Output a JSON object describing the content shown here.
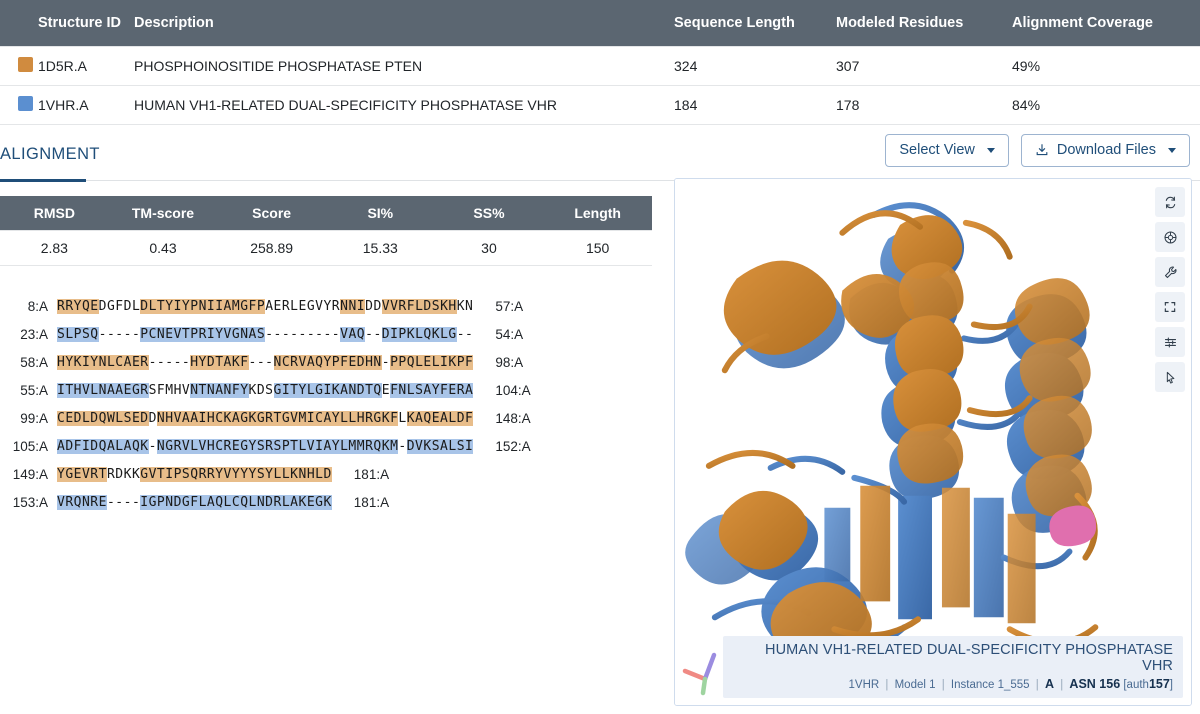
{
  "summary": {
    "columns": [
      "Structure ID",
      "Description",
      "Sequence Length",
      "Modeled Residues",
      "Alignment Coverage"
    ],
    "rows": [
      {
        "color": "#d08b3f",
        "id": "1D5R.A",
        "description": "PHOSPHOINOSITIDE PHOSPHATASE PTEN",
        "sequence_length": "324",
        "modeled_residues": "307",
        "alignment_coverage": "49%"
      },
      {
        "color": "#5b8fd0",
        "id": "1VHR.A",
        "description": "HUMAN VH1-RELATED DUAL-SPECIFICITY PHOSPHATASE VHR",
        "sequence_length": "184",
        "modeled_residues": "178",
        "alignment_coverage": "84%"
      }
    ]
  },
  "tabs": {
    "alignment_label": "ALIGNMENT"
  },
  "toolbar": {
    "select_view_label": "Select View",
    "download_files_label": "Download Files"
  },
  "metrics": {
    "columns": [
      "RMSD",
      "TM-score",
      "Score",
      "SI%",
      "SS%",
      "Length"
    ],
    "values": [
      "2.83",
      "0.43",
      "258.89",
      "15.33",
      "30",
      "150"
    ]
  },
  "alignment": {
    "rows": [
      {
        "start": "8:A",
        "end": "57:A",
        "color": "orange",
        "segments": [
          {
            "t": "RRYQE",
            "h": true
          },
          {
            "t": "DGFDL",
            "h": false
          },
          {
            "t": "DLTYIYPNIIAMGFP",
            "h": true
          },
          {
            "t": "AERLEGVYR",
            "h": false
          },
          {
            "t": "NNI",
            "h": true
          },
          {
            "t": "DD",
            "h": false
          },
          {
            "t": "VVRFLDSKH",
            "h": true
          },
          {
            "t": "KN",
            "h": false
          }
        ]
      },
      {
        "start": "23:A",
        "end": "54:A",
        "color": "blue",
        "segments": [
          {
            "t": "SLPSQ",
            "h": true
          },
          {
            "t": "-----",
            "h": false
          },
          {
            "t": "PCNEVTPRIYVGNAS",
            "h": true
          },
          {
            "t": "---------",
            "h": false
          },
          {
            "t": "VAQ",
            "h": true
          },
          {
            "t": "--",
            "h": false
          },
          {
            "t": "DIPKLQKLG",
            "h": true
          },
          {
            "t": "--",
            "h": false
          }
        ]
      },
      {
        "start": "58:A",
        "end": "98:A",
        "color": "orange",
        "segments": [
          {
            "t": "HYKIYNLCAER",
            "h": true
          },
          {
            "t": "-----",
            "h": false
          },
          {
            "t": "HYDTAKF",
            "h": true
          },
          {
            "t": "---",
            "h": false
          },
          {
            "t": "NCRVAQYPFEDHN",
            "h": true
          },
          {
            "t": "-",
            "h": false
          },
          {
            "t": "PPQLELIKPF",
            "h": true
          }
        ]
      },
      {
        "start": "55:A",
        "end": "104:A",
        "color": "blue",
        "segments": [
          {
            "t": "ITHVLNAAEGR",
            "h": true
          },
          {
            "t": "SFMHV",
            "h": false
          },
          {
            "t": "NTNANFY",
            "h": true
          },
          {
            "t": "KDS",
            "h": false
          },
          {
            "t": "GITYLGIKANDTQ",
            "h": true
          },
          {
            "t": "E",
            "h": false
          },
          {
            "t": "FNLSAYFERA",
            "h": true
          }
        ]
      },
      {
        "start": "99:A",
        "end": "148:A",
        "color": "orange",
        "segments": [
          {
            "t": "CEDLDQWLSED",
            "h": true
          },
          {
            "t": "D",
            "h": false
          },
          {
            "t": "NHVAAIHCKAGKGRTGVMICAYLLHRGKF",
            "h": true
          },
          {
            "t": "L",
            "h": false
          },
          {
            "t": "KAQEALDF",
            "h": true
          }
        ]
      },
      {
        "start": "105:A",
        "end": "152:A",
        "color": "blue",
        "segments": [
          {
            "t": "ADFIDQALAQK",
            "h": true
          },
          {
            "t": "-",
            "h": false
          },
          {
            "t": "NGRVLVHCREGYSRSPTLVIAYLMMRQKM",
            "h": true
          },
          {
            "t": "-",
            "h": false
          },
          {
            "t": "DVKSALSI",
            "h": true
          }
        ]
      },
      {
        "start": "149:A",
        "end": "181:A",
        "color": "orange",
        "segments": [
          {
            "t": "YGEVRT",
            "h": true
          },
          {
            "t": "RDKK",
            "h": false
          },
          {
            "t": "GVTIPSQRRYVYYYSYLLKNHLD",
            "h": true
          }
        ]
      },
      {
        "start": "153:A",
        "end": "181:A",
        "color": "blue",
        "segments": [
          {
            "t": "VRQNRE",
            "h": true
          },
          {
            "t": "----",
            "h": false
          },
          {
            "t": "IGPNDGFLAQLCQLNDRLAKEGK",
            "h": true
          }
        ]
      }
    ]
  },
  "viewer": {
    "tools": [
      {
        "name": "reset-camera-icon"
      },
      {
        "name": "focus-target-icon"
      },
      {
        "name": "wrench-settings-icon"
      },
      {
        "name": "fullscreen-icon"
      },
      {
        "name": "sliders-settings-icon"
      },
      {
        "name": "selection-cursor-icon"
      }
    ],
    "caption_title": "HUMAN VH1-RELATED DUAL-SPECIFICITY PHOSPHATASE VHR",
    "caption_entry": "1VHR",
    "caption_model": "Model 1",
    "caption_instance": "Instance 1_555",
    "caption_chain": "A",
    "caption_residue": "ASN 156",
    "caption_auth_label": "[auth",
    "caption_auth_value": "157",
    "caption_auth_close": "]",
    "structure_colors": {
      "chain_a": "#c8802c",
      "chain_b": "#4a7ebb",
      "highlight": "#e06fae"
    }
  }
}
